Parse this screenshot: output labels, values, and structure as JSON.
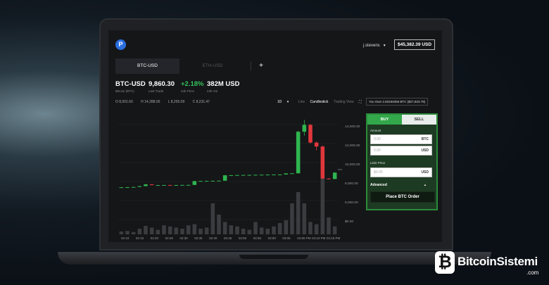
{
  "header": {
    "username": "j.stevens",
    "balance": "$45,382.39 USD"
  },
  "tabs": [
    {
      "label": "BTC-USD",
      "active": true
    },
    {
      "label": "ETH-USD",
      "active": false
    }
  ],
  "stats": [
    {
      "value": "BTC-USD",
      "label": "Bitcoin (BTC)"
    },
    {
      "value": "9,860.30",
      "label": "Last Trade"
    },
    {
      "value": "+2.18%",
      "label": "24h Price"
    },
    {
      "value": "382M USD",
      "label": "24h Vol"
    }
  ],
  "ohlc": {
    "open": "O 8,001.60",
    "high": "H 14,288.00",
    "low": "L 8,255.09",
    "close": "C 8,231.47"
  },
  "chart_controls": {
    "interval": "1D",
    "line": "Line",
    "candlestick": "Candlestick",
    "trading_view": "Trading View"
  },
  "own_text": "You Own 2.83194056 BTC ($27,923.79)",
  "chart_data": {
    "type": "candlestick",
    "x_tick_labels": [
      "02:10",
      "02:15",
      "02:20",
      "02:25",
      "02:30",
      "02:35",
      "02:40",
      "02:45",
      "02:50",
      "02:55",
      "03:00",
      "03:05",
      "04:55 PM",
      "04:10 PM",
      "04:15 PM"
    ],
    "y_tick_labels": [
      "14,000.00",
      "12,000.00",
      "10,000.00",
      "8,000.00",
      "6,000.00",
      "$0.00"
    ],
    "ylim": [
      8000,
      15000
    ],
    "colors": {
      "up": "#2fb54f",
      "down": "#e0373c",
      "volume": "#3a3c40"
    },
    "candles": [
      [
        8050,
        8080,
        8040,
        8060
      ],
      [
        8060,
        8090,
        8050,
        8070
      ],
      [
        8070,
        8100,
        8060,
        8090
      ],
      [
        8100,
        8200,
        8080,
        8180
      ],
      [
        8180,
        8380,
        8170,
        8360
      ],
      [
        8360,
        8380,
        8260,
        8280
      ],
      [
        8280,
        8300,
        8260,
        8280
      ],
      [
        8280,
        8300,
        8270,
        8290
      ],
      [
        8290,
        8310,
        8270,
        8280
      ],
      [
        8280,
        8300,
        8270,
        8290
      ],
      [
        8290,
        8310,
        8280,
        8300
      ],
      [
        8300,
        8320,
        8290,
        8300
      ],
      [
        8300,
        8700,
        8290,
        8690
      ],
      [
        8690,
        8710,
        8680,
        8700
      ],
      [
        8700,
        8720,
        8690,
        8710
      ],
      [
        8710,
        8730,
        8700,
        8720
      ],
      [
        8720,
        8740,
        8710,
        8730
      ],
      [
        8730,
        9300,
        8720,
        9280
      ],
      [
        9280,
        9300,
        9270,
        9290
      ],
      [
        9290,
        9310,
        9280,
        9300
      ],
      [
        9300,
        9320,
        9290,
        9310
      ],
      [
        9310,
        9330,
        9300,
        9320
      ],
      [
        9320,
        9340,
        9310,
        9330
      ],
      [
        9330,
        9350,
        9320,
        9340
      ],
      [
        9340,
        9360,
        9330,
        9350
      ],
      [
        9350,
        9370,
        9340,
        9360
      ],
      [
        9360,
        9370,
        9350,
        9360
      ],
      [
        9360,
        9480,
        9350,
        9470
      ],
      [
        9470,
        9490,
        9460,
        9480
      ],
      [
        9480,
        13800,
        9470,
        13700
      ],
      [
        13700,
        14900,
        13300,
        14400
      ],
      [
        14400,
        14500,
        12500,
        12600
      ],
      [
        12600,
        12700,
        11800,
        12200
      ],
      [
        12200,
        12300,
        8900,
        8950
      ],
      [
        8950,
        9000,
        8850,
        8900
      ],
      [
        8900,
        9600,
        8880,
        9550
      ]
    ],
    "volume": [
      0.05,
      0.06,
      0.04,
      0.1,
      0.15,
      0.12,
      0.08,
      0.16,
      0.14,
      0.12,
      0.1,
      0.16,
      0.18,
      0.1,
      0.12,
      0.55,
      0.35,
      0.22,
      0.16,
      0.14,
      0.1,
      0.08,
      0.22,
      0.12,
      0.1,
      0.14,
      0.2,
      0.25,
      0.55,
      0.75,
      0.55,
      0.22,
      0.18,
      1.0,
      0.3,
      0.14
    ]
  },
  "order_panel": {
    "buy_tab": "BUY",
    "sell_tab": "SELL",
    "amount_label": "Amount",
    "amount_btc_placeholder": "0.00",
    "amount_btc_unit": "BTC",
    "amount_usd_placeholder": "0.00",
    "amount_usd_unit": "USD",
    "limit_label": "Limit Price",
    "limit_placeholder": "$0.00",
    "limit_unit": "USD",
    "advanced": "Advanced",
    "place_button": "Place BTC Order"
  },
  "watermark": {
    "name": "BitcoinSistemi",
    "domain": ".com"
  }
}
